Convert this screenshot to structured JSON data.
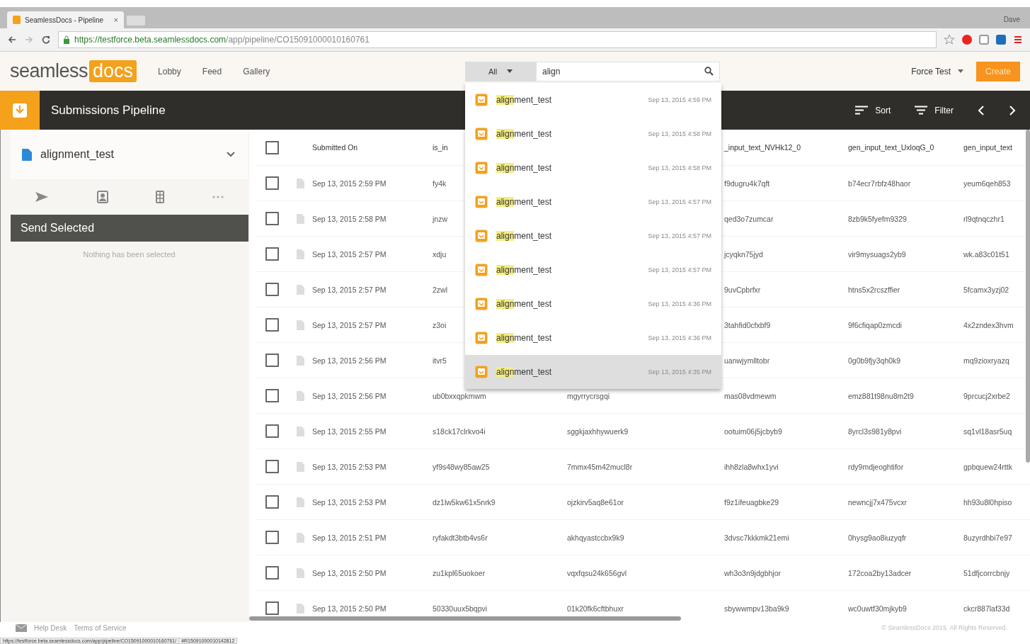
{
  "browser": {
    "tab_title": "SeamlessDocs - Pipeline",
    "tab_close": "×",
    "user": "Dave",
    "url_host": "https://testforce.beta.seamlessdocs.com",
    "url_path": "/app/pipeline/CO15091000010160761"
  },
  "header": {
    "logo_plain": "seamless",
    "logo_boxed": "docs",
    "nav": [
      "Lobby",
      "Feed",
      "Gallery"
    ],
    "search_scope": "All",
    "search_value": "align",
    "account": "Force Test",
    "create_button": "Create"
  },
  "search_results": [
    {
      "match": "align",
      "rest": "ment_test",
      "date": "Sep 13, 2015 4:59 PM",
      "selected": false
    },
    {
      "match": "align",
      "rest": "ment_test",
      "date": "Sep 13, 2015 4:58 PM",
      "selected": false
    },
    {
      "match": "align",
      "rest": "ment_test",
      "date": "Sep 13, 2015 4:58 PM",
      "selected": false
    },
    {
      "match": "align",
      "rest": "ment_test",
      "date": "Sep 13, 2015 4:57 PM",
      "selected": false
    },
    {
      "match": "align",
      "rest": "ment_test",
      "date": "Sep 13, 2015 4:57 PM",
      "selected": false
    },
    {
      "match": "align",
      "rest": "ment_test",
      "date": "Sep 13, 2015 4:57 PM",
      "selected": false
    },
    {
      "match": "align",
      "rest": "ment_test",
      "date": "Sep 13, 2015 4:36 PM",
      "selected": false
    },
    {
      "match": "align",
      "rest": "ment_test",
      "date": "Sep 13, 2015 4:36 PM",
      "selected": false
    },
    {
      "match": "align",
      "rest": "ment_test",
      "date": "Sep 13, 2015 4:35 PM",
      "selected": true
    }
  ],
  "toolbar": {
    "title": "Submissions Pipeline",
    "sort": "Sort",
    "filter": "Filter"
  },
  "sidebar": {
    "form": "alignment_test",
    "send_button": "Send Selected",
    "empty_note": "Nothing has been selected"
  },
  "table": {
    "header_checked": false,
    "columns": [
      {
        "label": "Submitted On"
      },
      {
        "label": "is_in"
      },
      {},
      {
        "label": "_input_text_NVHk12_0"
      },
      {
        "label": "gen_input_text_UxloqG_0"
      },
      {
        "label": "gen_input_text"
      }
    ],
    "rows": [
      {
        "checked": false,
        "cells": [
          "Sep 13, 2015 2:59 PM",
          "fy4k",
          null,
          "f9dugru4k7qft",
          "b74ecr7rbfz48haor",
          "yeum6qeh853"
        ]
      },
      {
        "checked": false,
        "cells": [
          "Sep 13, 2015 2:58 PM",
          "jnzw",
          null,
          "qed3o7zumcar",
          "8zb9k5fyefm9329",
          "rl9qtnqczhr1"
        ]
      },
      {
        "checked": false,
        "cells": [
          "Sep 13, 2015 2:57 PM",
          "xdju",
          null,
          "jcyqkn75jyd",
          "vir9mysuags2yb9",
          "wk.a83c01t51"
        ]
      },
      {
        "checked": false,
        "cells": [
          "Sep 13, 2015 2:57 PM",
          "2zwl",
          null,
          "9uvCpbrfxr",
          "htns5x2rcszffier",
          "5fcamx3yzj02"
        ]
      },
      {
        "checked": false,
        "cells": [
          "Sep 13, 2015 2:57 PM",
          "z3oi",
          null,
          "3tahfid0cfxbf9",
          "9f6cfiqap0zmcdi",
          "4x2zndex3hvm"
        ]
      },
      {
        "checked": false,
        "cells": [
          "Sep 13, 2015 2:56 PM",
          "itvr5",
          null,
          "uanwjymlltobr",
          "0g0b9fjy3qh0k9",
          "mq9zioxryazq"
        ]
      },
      {
        "checked": false,
        "cells": [
          "Sep 13, 2015 2:56 PM",
          "ub0bxxqpkmwm",
          "mgyrrycrsgqi",
          "mas08vdmewm",
          "emz881t98nu8m2t9",
          "9prcucj2xrbe2"
        ]
      },
      {
        "checked": false,
        "cells": [
          "Sep 13, 2015 2:55 PM",
          "s18ck17clrkvo4i",
          "sggkjaxhhywuerk9",
          "ootuim06j5jcbyb9",
          "8yrcl3s981y8pvi",
          "sq1vl18asr5uq"
        ]
      },
      {
        "checked": false,
        "cells": [
          "Sep 13, 2015 2:53 PM",
          "yf9s48wy85aw25",
          "7mmx45m42mucl8r",
          "ihh8zla8whx1yvi",
          "rdy9mdjeoghtifor",
          "gpbquew24rttk"
        ]
      },
      {
        "checked": false,
        "cells": [
          "Sep 13, 2015 2:53 PM",
          "dz1lw5kw61x5nrk9",
          "ojzkirv5aq8e61or",
          "f9z1ifeuagbke29",
          "newncjj7x475vcxr",
          "hh93u8l0hpiso"
        ]
      },
      {
        "checked": false,
        "cells": [
          "Sep 13, 2015 2:51 PM",
          "ryfakdt3btb4vs6r",
          "akhqyastccbx9k9",
          "3dvsc7kkkmk21emi",
          "0hysg9ao8iuzyqfr",
          "8uzyrdhbi7e97"
        ]
      },
      {
        "checked": false,
        "cells": [
          "Sep 13, 2015 2:50 PM",
          "zu1kpl65uokoer",
          "vqxfqsu24k656gvl",
          "wh3o3n9jdgbhjor",
          "172coa2by13adcer",
          "51dfjcorrcbnjy"
        ]
      },
      {
        "checked": false,
        "cells": [
          "Sep 13, 2015 2:50 PM",
          "50330uux5bqpvi",
          "01k20fk6cftbhuxr",
          "sbywwmpv13ba9k9",
          "wc0uwtf30mjkyb9",
          "ckcr887laf33d"
        ]
      }
    ]
  },
  "footer": {
    "links": [
      "Help Desk",
      "Terms of Service"
    ],
    "copyright": "© SeamlessDocs 2015. All Rights Reserved.",
    "status_url": "https://testforce.beta.seamlessdocs.com/app/pipeline/CO15091000010160761/",
    "status_hash": "#R15091000010142812"
  }
}
